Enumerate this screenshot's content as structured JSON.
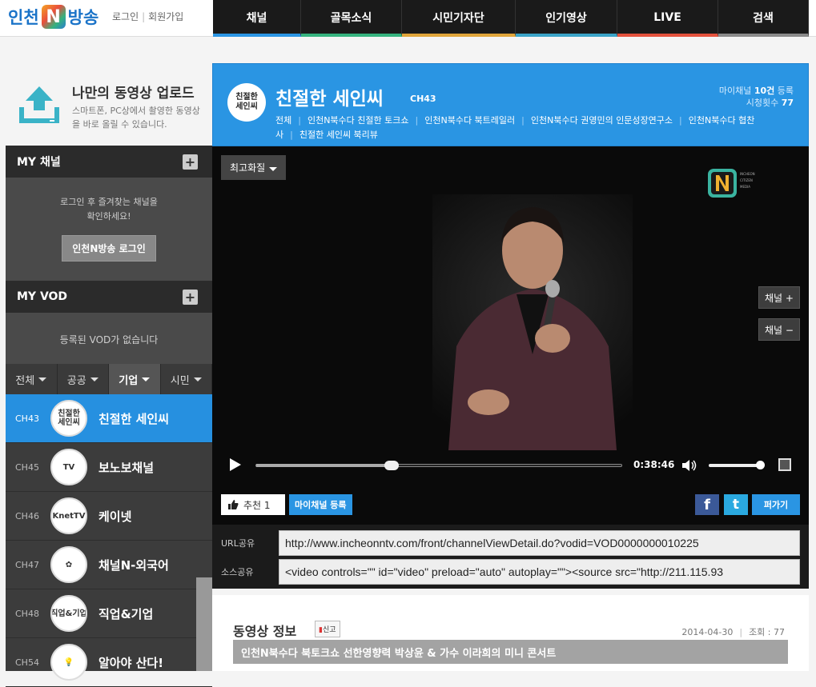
{
  "header": {
    "logo_left": "인천",
    "logo_n": "N",
    "logo_right": "방송",
    "login": "로그인",
    "signup": "회원가입"
  },
  "nav": [
    {
      "label": "채널",
      "color": "#2a95e3",
      "width": 110
    },
    {
      "label": "골목소식",
      "color": "#35b37e",
      "width": 126
    },
    {
      "label": "시민기자단",
      "color": "#e0a53a",
      "width": 142
    },
    {
      "label": "인기영상",
      "color": "#3aa3c7",
      "width": 127
    },
    {
      "label": "LIVE",
      "color": "#e3513c",
      "width": 126
    },
    {
      "label": "검색",
      "color": "#8a8a8a",
      "width": 113
    }
  ],
  "upload": {
    "title": "나만의 동영상 업로드",
    "desc": "스마트폰, PC상에서 촬영한 동영상을 바로 올릴 수 있습니다."
  },
  "sidebar": {
    "my_channel": "MY 채널",
    "my_channel_msg_1": "로그인 후 즐겨찾는 채널을",
    "my_channel_msg_2": "확인하세요!",
    "login_button": "인천N방송 로그인",
    "my_vod": "MY VOD",
    "my_vod_msg": "등록된 VOD가 없습니다",
    "tabs": [
      "전체",
      "공공",
      "기업",
      "시민"
    ],
    "active_tab": 2,
    "channels": [
      {
        "num": "CH43",
        "name": "친절한 세인씨",
        "logo": "친절한\n세인씨",
        "active": true
      },
      {
        "num": "CH45",
        "name": "보노보채널",
        "logo": "TV",
        "active": false
      },
      {
        "num": "CH46",
        "name": "케이넷",
        "logo": "KnetTV",
        "active": false
      },
      {
        "num": "CH47",
        "name": "채널N-외국어",
        "logo": "✿",
        "active": false
      },
      {
        "num": "CH48",
        "name": "직업&기업",
        "logo": "직업&기업",
        "active": false
      },
      {
        "num": "CH54",
        "name": "알아야 산다!",
        "logo": "💡",
        "active": false
      }
    ]
  },
  "channel": {
    "badge": "친절한\n세인씨",
    "title": "친절한 세인씨",
    "number": "CH43",
    "stats_line1_pre": "마이채널 ",
    "stats_line1_count": "10건",
    "stats_line1_post": " 등록",
    "stats_line2_pre": "시청횟수 ",
    "stats_line2_count": "77",
    "links": [
      "전체",
      "인천N북수다 친절한 토크쇼",
      "인천N북수다 북트레일러",
      "인천N북수다 권영민의 인문성장연구소",
      "인천N북수다 협찬사",
      "친절한 세인씨 북리뷰"
    ]
  },
  "player": {
    "quality": "최고화질",
    "ch_up": "채널 +",
    "ch_down": "채널 −",
    "time": "0:38:46",
    "progress": 0.37,
    "volume": 1.0
  },
  "actions": {
    "recommend": "추천 1",
    "my_channel_register": "마이채널 등록",
    "facebook": "f",
    "twitter": "t",
    "share": "퍼가기"
  },
  "share_codes": {
    "url_label": "URL공유",
    "url_value": "http://www.incheonntv.com/front/channelViewDetail.do?vodid=VOD0000000010225",
    "src_label": "소스공유",
    "src_value": "<video controls=\"\" id=\"video\" preload=\"auto\" autoplay=\"\"><source src=\"http://211.115.93"
  },
  "video_info": {
    "heading": "동영상 정보",
    "report": "신고",
    "date": "2014-04-30",
    "views": "조회 : 77",
    "subject": "인천N북수다 북토크쇼 선한영향력 박상윤 & 가수 이라희의 미니 콘서트"
  }
}
